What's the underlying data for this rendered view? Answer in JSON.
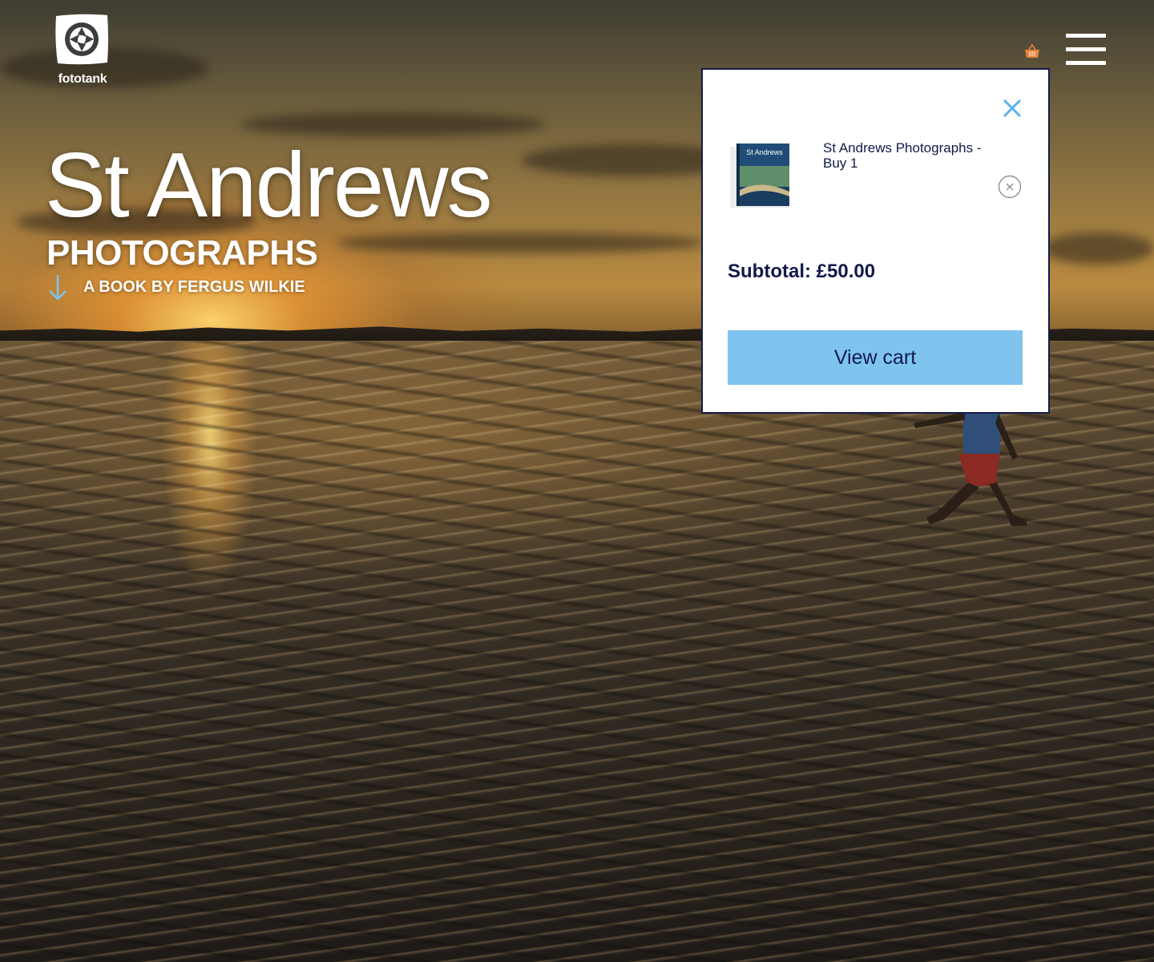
{
  "brand": {
    "name": "fototank",
    "logo_icon": "camera-aperture-icon"
  },
  "hero": {
    "title": "St Andrews",
    "subtitle": "PHOTOGRAPHS",
    "byline": "A BOOK BY FERGUS WILKIE",
    "scroll_icon": "arrow-down-icon",
    "background": "photo of tidal sand ripples at sunset with a child running"
  },
  "header": {
    "basket_icon": "basket-icon",
    "menu_icon": "hamburger-menu-icon"
  },
  "cart_popup": {
    "close_icon": "close-icon",
    "items": [
      {
        "name": "St Andrews Photographs - Buy 1",
        "thumbnail_title": "St Andrews",
        "remove_icon": "remove-circle-icon"
      }
    ],
    "subtotal": "Subtotal: £50.00",
    "view_cart_label": "View cart"
  },
  "colors": {
    "accent_blue": "#7fc3ef",
    "navy": "#121a4a",
    "basket_orange": "#e8843a"
  }
}
